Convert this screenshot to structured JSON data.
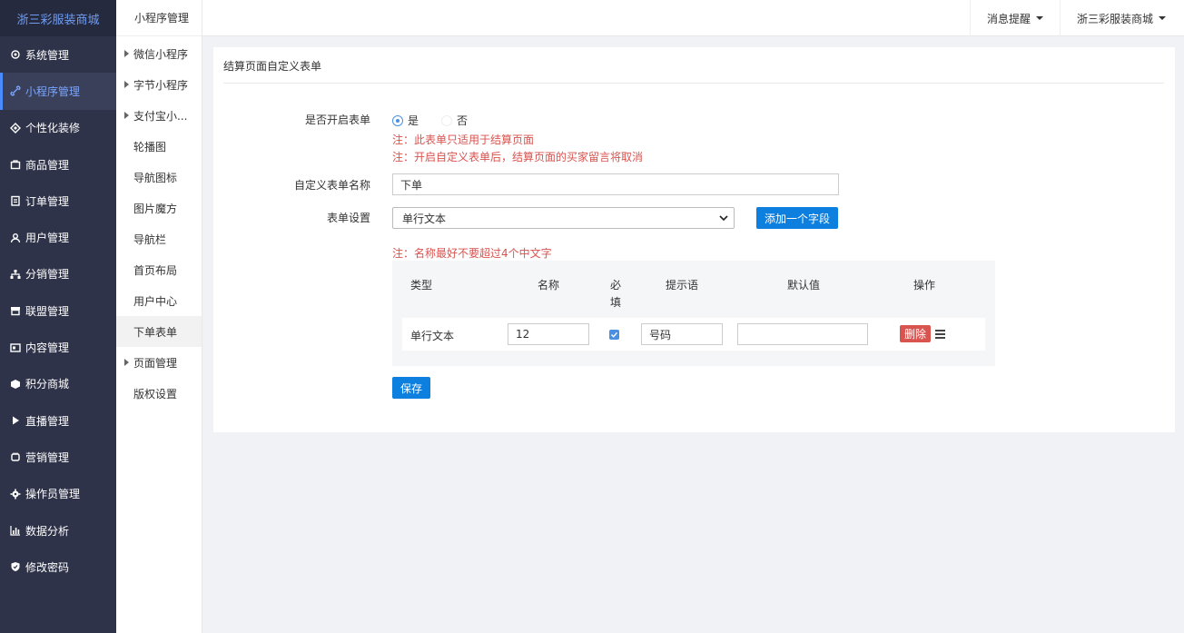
{
  "brand": "浙三彩服装商城",
  "sidebar": {
    "items": [
      {
        "label": "系统管理",
        "icon": "gear-outline-icon"
      },
      {
        "label": "小程序管理",
        "icon": "link-icon",
        "active": true
      },
      {
        "label": "个性化装修",
        "icon": "diamond-icon"
      },
      {
        "label": "商品管理",
        "icon": "bag-icon"
      },
      {
        "label": "订单管理",
        "icon": "clipboard-icon"
      },
      {
        "label": "用户管理",
        "icon": "user-icon"
      },
      {
        "label": "分销管理",
        "icon": "sitemap-icon"
      },
      {
        "label": "联盟管理",
        "icon": "store-icon"
      },
      {
        "label": "内容管理",
        "icon": "card-icon"
      },
      {
        "label": "积分商城",
        "icon": "cube-icon"
      },
      {
        "label": "直播管理",
        "icon": "play-icon"
      },
      {
        "label": "营销管理",
        "icon": "fist-icon"
      },
      {
        "label": "操作员管理",
        "icon": "cog-icon"
      },
      {
        "label": "数据分析",
        "icon": "bar-chart-icon"
      },
      {
        "label": "修改密码",
        "icon": "shield-icon"
      }
    ]
  },
  "subbar": {
    "title": "小程序管理",
    "items": [
      {
        "label": "微信小程序",
        "tri": true
      },
      {
        "label": "字节小程序",
        "tri": true
      },
      {
        "label": "支付宝小...",
        "tri": true
      },
      {
        "label": "轮播图",
        "tri": false
      },
      {
        "label": "导航图标",
        "tri": false
      },
      {
        "label": "图片魔方",
        "tri": false
      },
      {
        "label": "导航栏",
        "tri": false
      },
      {
        "label": "首页布局",
        "tri": false
      },
      {
        "label": "用户中心",
        "tri": false
      },
      {
        "label": "下单表单",
        "tri": false,
        "active": true
      },
      {
        "label": "页面管理",
        "tri": true
      },
      {
        "label": "版权设置",
        "tri": false
      }
    ]
  },
  "topbar": {
    "notify": "消息提醒",
    "account": "浙三彩服装商城"
  },
  "panel": {
    "title": "结算页面自定义表单",
    "enable_label": "是否开启表单",
    "yes": "是",
    "no": "否",
    "note1": "注：此表单只适用于结算页面",
    "note2": "注：开启自定义表单后，结算页面的买家留言将取消",
    "name_label": "自定义表单名称",
    "name_value": "下单",
    "setting_label": "表单设置",
    "select_value": "单行文本",
    "add_field": "添加一个字段",
    "note3": "注：名称最好不要超过4个中文字",
    "save": "保存"
  },
  "table": {
    "headers": {
      "type": "类型",
      "name": "名称",
      "required_1": "必",
      "required_2": "填",
      "hint": "提示语",
      "default": "默认值",
      "ops": "操作"
    },
    "row": {
      "type": "单行文本",
      "name": "12",
      "required": true,
      "hint": "号码",
      "default": "",
      "delete": "删除"
    }
  },
  "colors": {
    "sidebar_bg": "#2f3349",
    "accent_blue": "#0c7fdf",
    "danger": "#d9534f"
  }
}
